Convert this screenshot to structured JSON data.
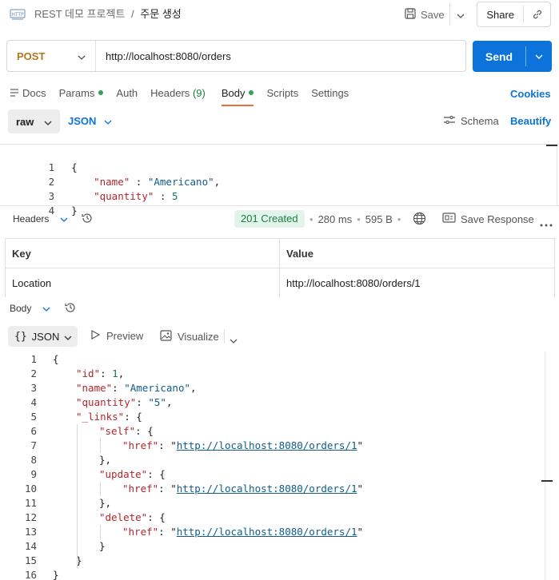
{
  "header": {
    "icon_label": "HTTP",
    "breadcrumb_project": "REST 데모 프로젝트",
    "breadcrumb_sep": "/",
    "breadcrumb_request": "주문 생성",
    "save_label": "Save",
    "share_label": "Share"
  },
  "request": {
    "method": "POST",
    "url": "http://localhost:8080/orders",
    "send_label": "Send"
  },
  "tabs": [
    {
      "label": "Docs"
    },
    {
      "label": "Params"
    },
    {
      "label": "Auth"
    },
    {
      "label": "Headers",
      "count": "(9)"
    },
    {
      "label": "Body"
    },
    {
      "label": "Scripts"
    },
    {
      "label": "Settings"
    }
  ],
  "cookies_label": "Cookies",
  "body_toolbar": {
    "mode": "raw",
    "format": "JSON",
    "schema_label": "Schema",
    "beautify_label": "Beautify"
  },
  "request_body": {
    "lines": [
      {
        "n": "1",
        "text": "{"
      },
      {
        "n": "2",
        "key": "\"name\"",
        "sep": " : ",
        "value": "\"Americano\"",
        "trail": ","
      },
      {
        "n": "3",
        "key": "\"quantity\"",
        "sep": " : ",
        "value": "5",
        "trail": ""
      },
      {
        "n": "4",
        "text": "}"
      }
    ]
  },
  "response": {
    "headers_label": "Headers",
    "status": "201 Created",
    "time": "280 ms",
    "size": "595 B",
    "save_response_label": "Save Response",
    "headers_table": {
      "columns": [
        "Key",
        "Value"
      ],
      "rows": [
        {
          "key": "Location",
          "value": "http://localhost:8080/orders/1"
        }
      ]
    },
    "body_label": "Body",
    "view_format": "JSON",
    "preview_label": "Preview",
    "visualize_label": "Visualize",
    "lines": [
      {
        "n": "1",
        "indent": 0,
        "parts": [
          {
            "t": "p",
            "v": "{"
          }
        ]
      },
      {
        "n": "2",
        "indent": 1,
        "parts": [
          {
            "t": "k",
            "v": "\"id\""
          },
          {
            "t": "p",
            "v": ": "
          },
          {
            "t": "num",
            "v": "1"
          },
          {
            "t": "p",
            "v": ","
          }
        ]
      },
      {
        "n": "3",
        "indent": 1,
        "parts": [
          {
            "t": "k",
            "v": "\"name\""
          },
          {
            "t": "p",
            "v": ": "
          },
          {
            "t": "s",
            "v": "\"Americano\""
          },
          {
            "t": "p",
            "v": ","
          }
        ]
      },
      {
        "n": "4",
        "indent": 1,
        "parts": [
          {
            "t": "k",
            "v": "\"quantity\""
          },
          {
            "t": "p",
            "v": ": "
          },
          {
            "t": "s",
            "v": "\"5\""
          },
          {
            "t": "p",
            "v": ","
          }
        ]
      },
      {
        "n": "5",
        "indent": 1,
        "parts": [
          {
            "t": "k",
            "v": "\"_links\""
          },
          {
            "t": "p",
            "v": ": {"
          }
        ]
      },
      {
        "n": "6",
        "indent": 2,
        "parts": [
          {
            "t": "k",
            "v": "\"self\""
          },
          {
            "t": "p",
            "v": ": {"
          }
        ]
      },
      {
        "n": "7",
        "indent": 3,
        "parts": [
          {
            "t": "k",
            "v": "\"href\""
          },
          {
            "t": "p",
            "v": ": \""
          },
          {
            "t": "l",
            "v": "http://localhost:8080/orders/1"
          },
          {
            "t": "p",
            "v": "\""
          }
        ]
      },
      {
        "n": "8",
        "indent": 2,
        "parts": [
          {
            "t": "p",
            "v": "},"
          }
        ]
      },
      {
        "n": "9",
        "indent": 2,
        "parts": [
          {
            "t": "k",
            "v": "\"update\""
          },
          {
            "t": "p",
            "v": ": {"
          }
        ]
      },
      {
        "n": "10",
        "indent": 3,
        "parts": [
          {
            "t": "k",
            "v": "\"href\""
          },
          {
            "t": "p",
            "v": ": \""
          },
          {
            "t": "l",
            "v": "http://localhost:8080/orders/1"
          },
          {
            "t": "p",
            "v": "\""
          }
        ]
      },
      {
        "n": "11",
        "indent": 2,
        "parts": [
          {
            "t": "p",
            "v": "},"
          }
        ]
      },
      {
        "n": "12",
        "indent": 2,
        "parts": [
          {
            "t": "k",
            "v": "\"delete\""
          },
          {
            "t": "p",
            "v": ": {"
          }
        ]
      },
      {
        "n": "13",
        "indent": 3,
        "parts": [
          {
            "t": "k",
            "v": "\"href\""
          },
          {
            "t": "p",
            "v": ": \""
          },
          {
            "t": "l",
            "v": "http://localhost:8080/orders/1"
          },
          {
            "t": "p",
            "v": "\""
          }
        ]
      },
      {
        "n": "14",
        "indent": 2,
        "parts": [
          {
            "t": "p",
            "v": "}"
          }
        ]
      },
      {
        "n": "15",
        "indent": 1,
        "parts": [
          {
            "t": "p",
            "v": "}"
          }
        ]
      },
      {
        "n": "16",
        "indent": 0,
        "parts": [
          {
            "t": "p",
            "v": "}"
          }
        ]
      }
    ]
  },
  "colors": {
    "accent": "#0b73da",
    "method": "#b5761b",
    "status_bg": "#e3f5ea",
    "status_fg": "#17803d",
    "dot": "#2ea44f"
  },
  "icons": [
    "http-icon",
    "save-icon",
    "chevron-down-icon",
    "link-icon",
    "history-icon",
    "globe-icon",
    "save-response-icon",
    "more-icon",
    "play-icon",
    "image-icon",
    "schema-icon",
    "docs-icon"
  ]
}
